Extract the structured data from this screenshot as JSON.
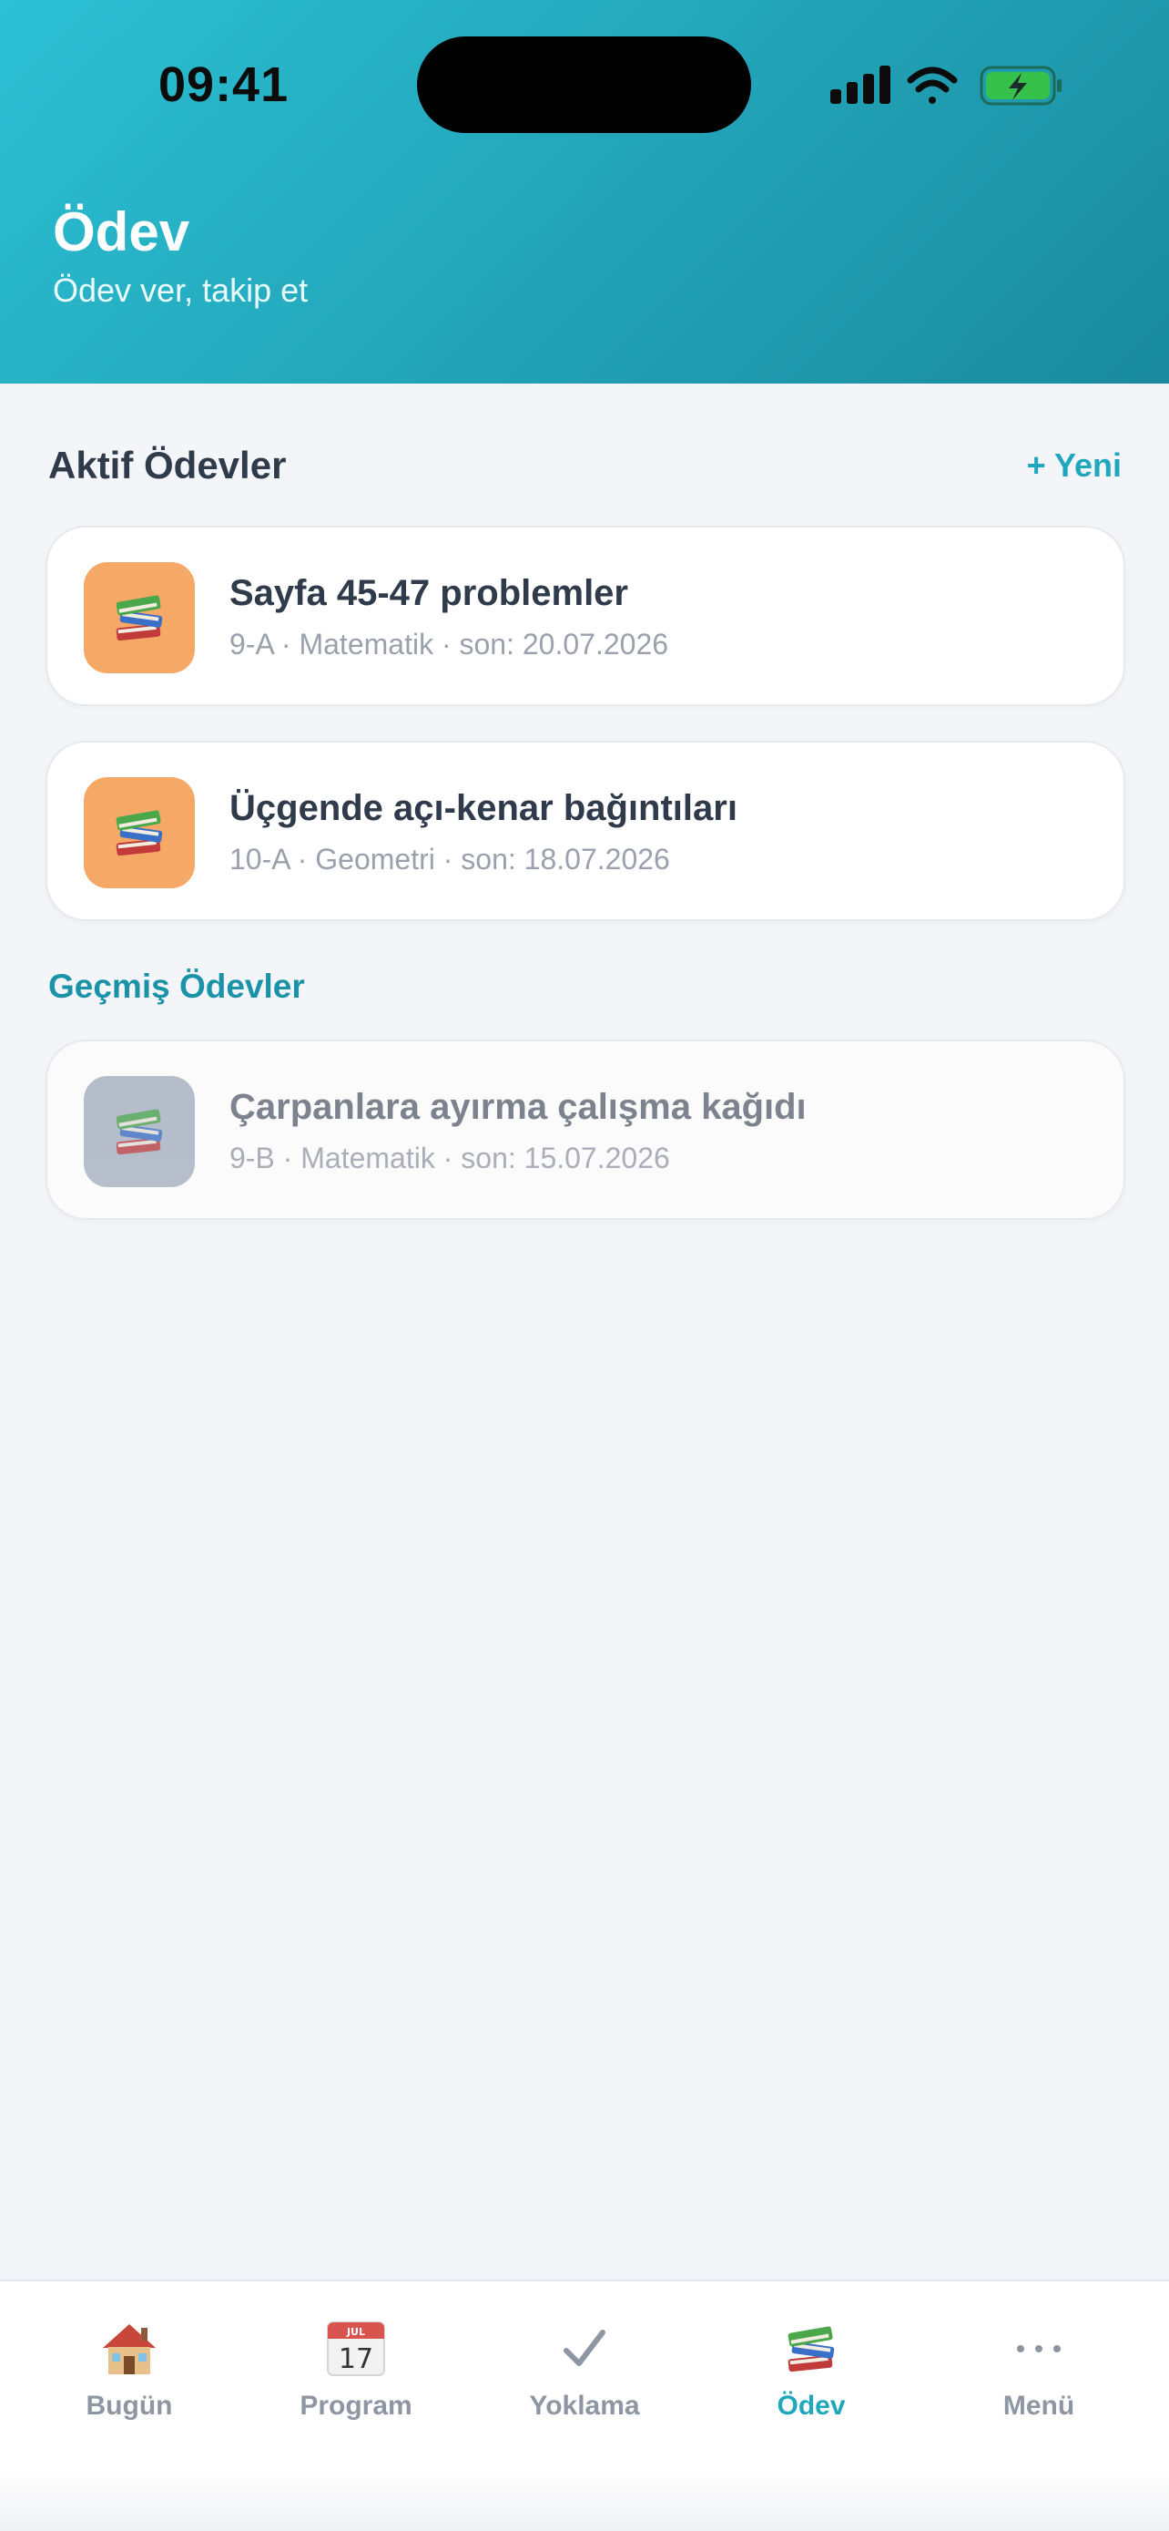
{
  "status": {
    "time": "09:41"
  },
  "header": {
    "title": "Ödev",
    "subtitle": "Ödev ver, takip et"
  },
  "active": {
    "title": "Aktif Ödevler",
    "new_label": "+ Yeni",
    "items": [
      {
        "title": "Sayfa 45-47 problemler",
        "meta": "9-A · Matematik · son: 20.07.2026",
        "icon": "books-icon"
      },
      {
        "title": "Üçgende açı-kenar bağıntıları",
        "meta": "10-A · Geometri · son: 18.07.2026",
        "icon": "books-icon"
      }
    ]
  },
  "past": {
    "title": "Geçmiş Ödevler",
    "items": [
      {
        "title": "Çarpanlara ayırma çalışma kağıdı",
        "meta": "9-B · Matematik · son: 15.07.2026",
        "icon": "books-icon"
      }
    ]
  },
  "tabs": [
    {
      "label": "Bugün",
      "icon": "house-icon"
    },
    {
      "label": "Program",
      "icon": "calendar-icon"
    },
    {
      "label": "Yoklama",
      "icon": "check-icon"
    },
    {
      "label": "Ödev",
      "icon": "books-icon",
      "active": true
    },
    {
      "label": "Menü",
      "icon": "more-icon"
    }
  ],
  "calendar_icon": {
    "month": "JUL",
    "day": "17"
  },
  "colors": {
    "accent": "#1fa7bd",
    "header_start": "#2cc0d4",
    "header_end": "#1a8a9e",
    "active_icon_bg": "#f6a867",
    "past_icon_bg": "#b3bac8"
  }
}
